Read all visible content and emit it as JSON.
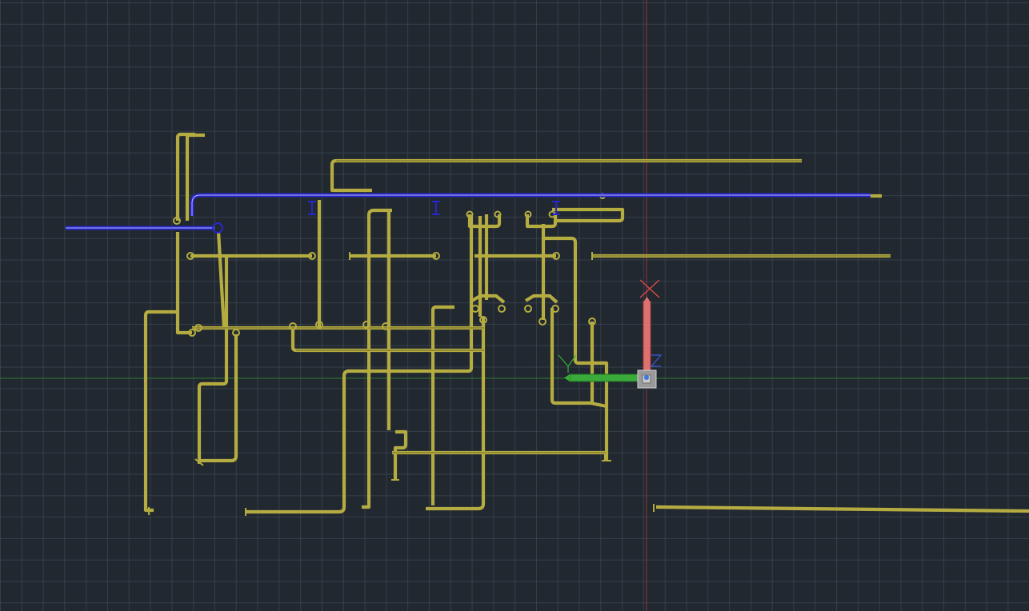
{
  "viewport": {
    "background_color": "#212830",
    "grid_color": "#3a4350",
    "pipe_color": "#b5ac41",
    "selected_pipe_color": "#2727c8"
  },
  "ucs_gizmo": {
    "x_axis_color": "#e07070",
    "y_axis_color": "#3aaa3a",
    "z_axis_color": "#3a5ae0",
    "origin_icon": "ucs-origin-box-icon"
  }
}
